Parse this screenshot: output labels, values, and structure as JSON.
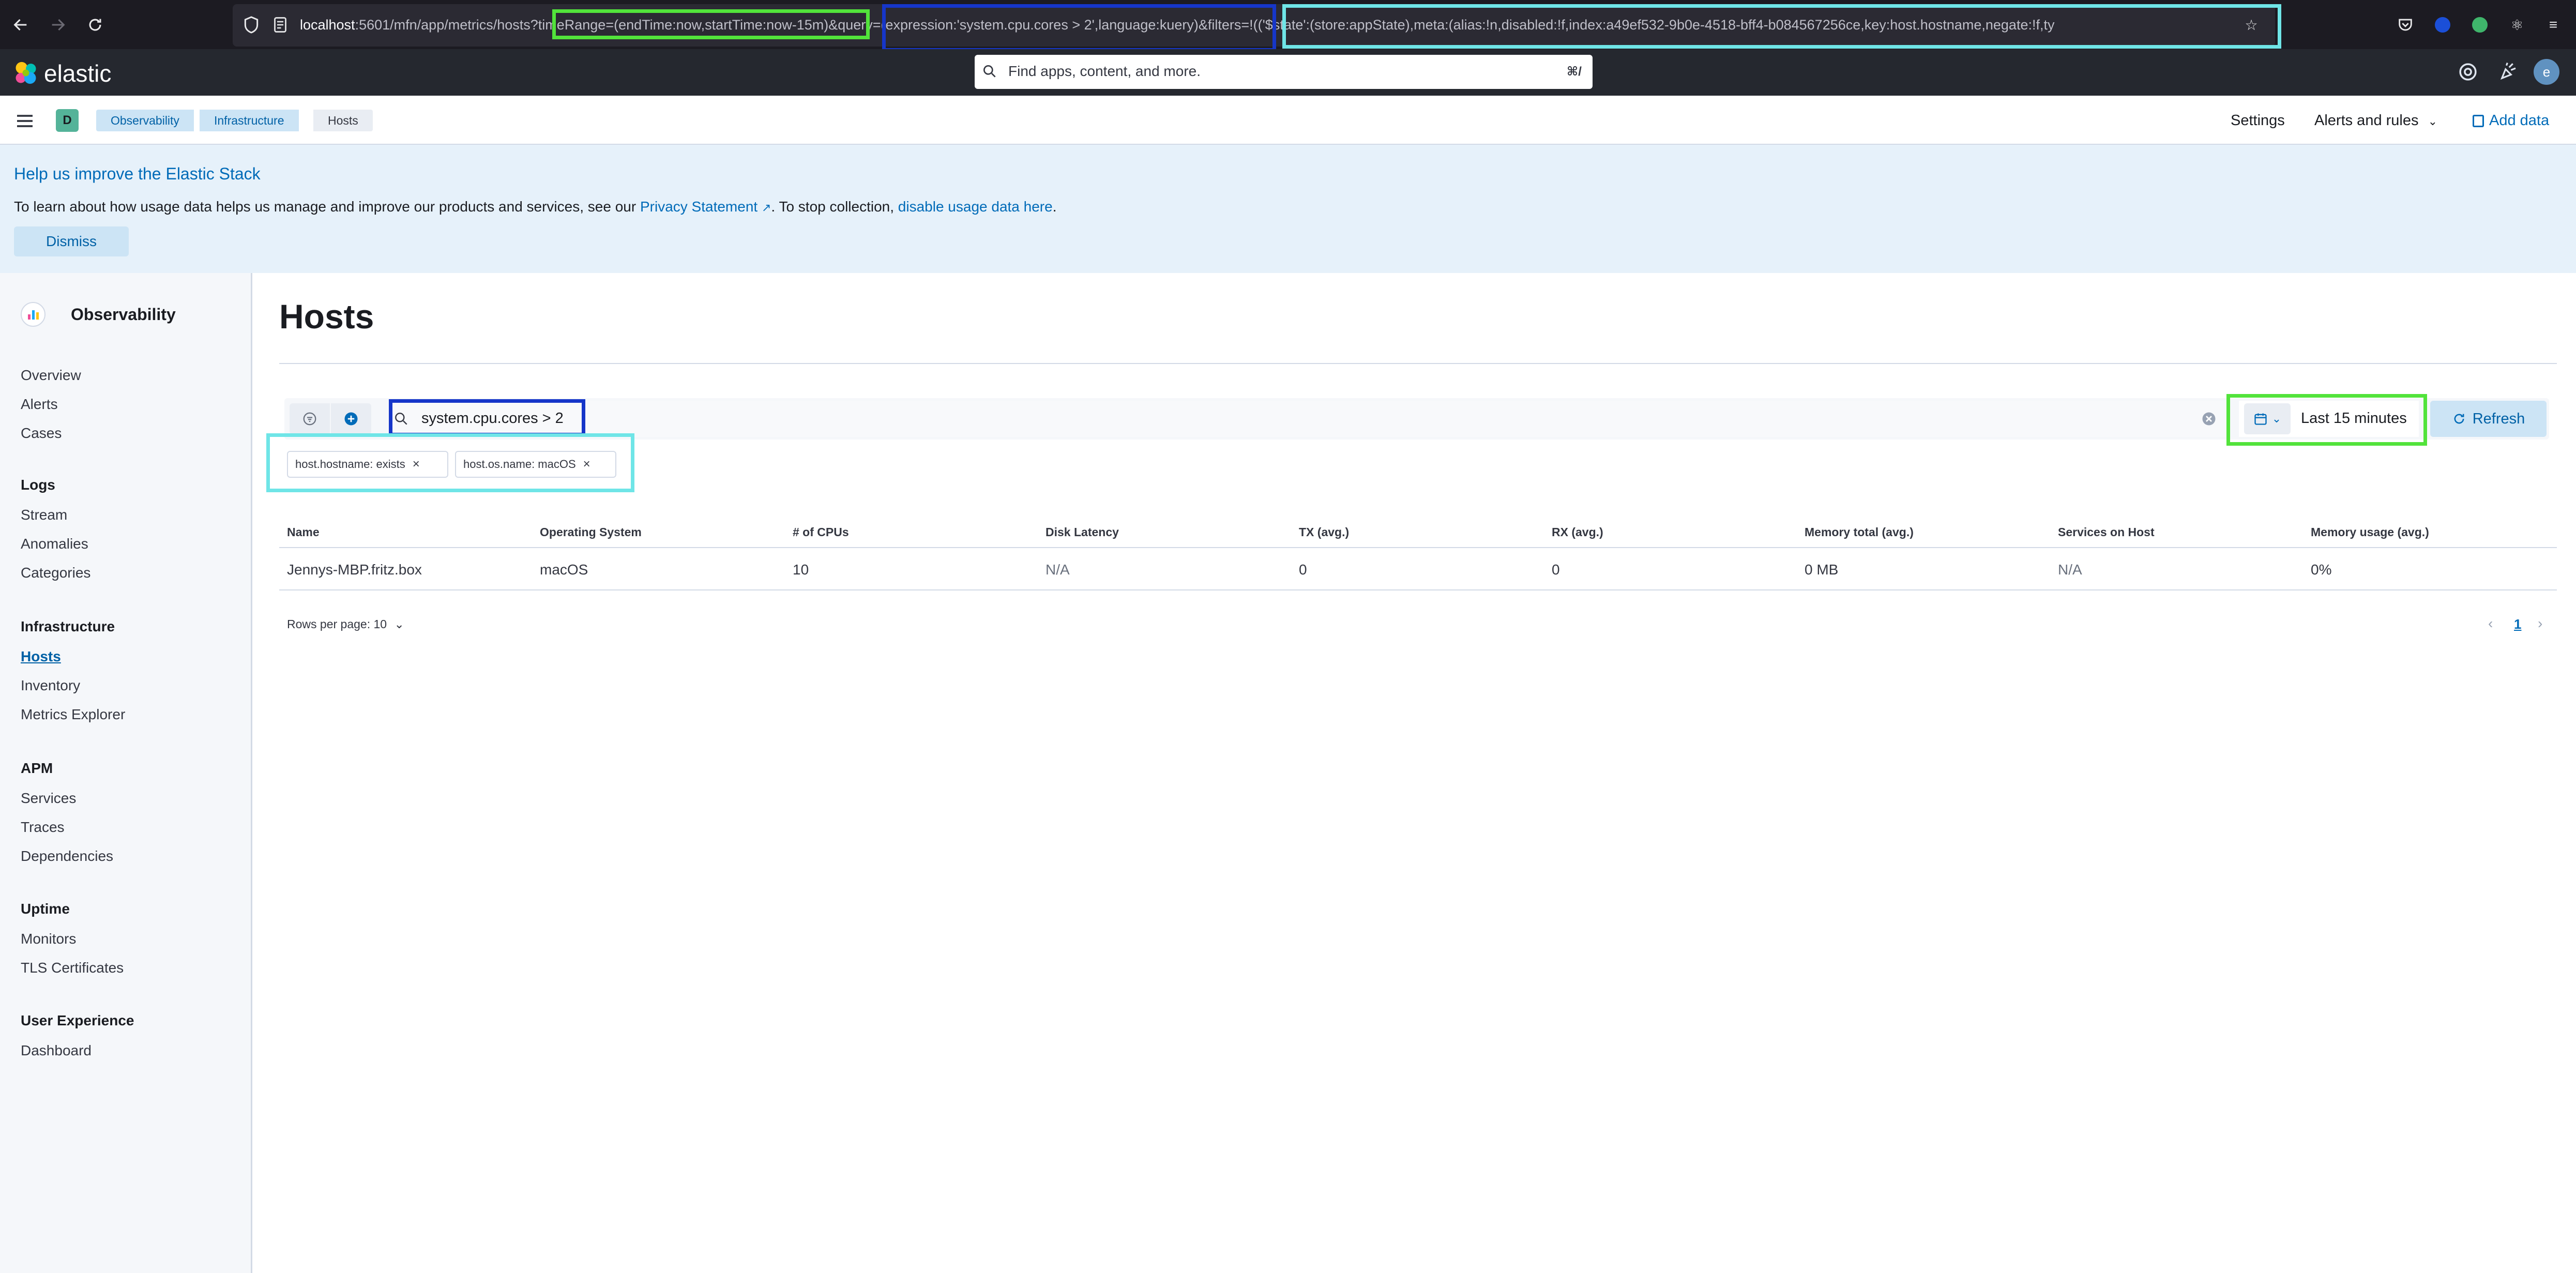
{
  "browser": {
    "url_host": "localhost",
    "url_rest": ":5601/mfn/app/metrics/hosts?timeRange=(endTime:now,startTime:now-15m)&query=(expression:'system.cpu.cores > 2',language:kuery)&filters=!(('$state':(store:appState),meta:(alias:!n,disabled:!f,index:a49ef532-9b0e-4518-bff4-b084567256ce,key:host.hostname,negate:!f,ty",
    "back_icon": "arrow-left-icon",
    "forward_icon": "arrow-right-icon",
    "reload_icon": "reload-icon"
  },
  "header": {
    "brand": "elastic",
    "search_placeholder": "Find apps, content, and more.",
    "search_shortcut": "⌘/",
    "avatar_letter": "e"
  },
  "subheader": {
    "space_letter": "D",
    "breadcrumbs": [
      "Observability",
      "Infrastructure",
      "Hosts"
    ],
    "settings": "Settings",
    "alerts_rules": "Alerts and rules",
    "add_data": "Add data"
  },
  "banner": {
    "title": "Help us improve the Elastic Stack",
    "body_pre": "To learn about how usage data helps us manage and improve our products and services, see our ",
    "privacy_link": "Privacy Statement",
    "body_mid": ". To stop collection, ",
    "disable_link": "disable usage data here",
    "body_end": ".",
    "dismiss": "Dismiss"
  },
  "sidebar": {
    "title": "Observability",
    "top_items": [
      "Overview",
      "Alerts",
      "Cases"
    ],
    "sections": [
      {
        "heading": "Logs",
        "items": [
          "Stream",
          "Anomalies",
          "Categories"
        ]
      },
      {
        "heading": "Infrastructure",
        "items": [
          "Hosts",
          "Inventory",
          "Metrics Explorer"
        ]
      },
      {
        "heading": "APM",
        "items": [
          "Services",
          "Traces",
          "Dependencies"
        ]
      },
      {
        "heading": "Uptime",
        "items": [
          "Monitors",
          "TLS Certificates"
        ]
      },
      {
        "heading": "User Experience",
        "items": [
          "Dashboard"
        ]
      }
    ],
    "active_item": "Hosts"
  },
  "main": {
    "title": "Hosts",
    "query": "system.cpu.cores > 2",
    "date_range": "Last 15 minutes",
    "refresh": "Refresh",
    "filters": [
      "host.hostname: exists",
      "host.os.name: macOS"
    ],
    "table": {
      "columns": [
        "Name",
        "Operating System",
        "# of CPUs",
        "Disk Latency",
        "TX (avg.)",
        "RX (avg.)",
        "Memory total (avg.)",
        "Services on Host",
        "Memory usage (avg.)"
      ],
      "rows": [
        [
          "Jennys-MBP.fritz.box",
          "macOS",
          "10",
          "N/A",
          "0",
          "0",
          "0 MB",
          "N/A",
          "0%"
        ]
      ]
    },
    "rows_per_page": "Rows per page: 10",
    "current_page": "1"
  },
  "colors": {
    "highlight_green": "#52e33b",
    "highlight_blue": "#1636c9",
    "highlight_cyan": "#6fe5e7",
    "accent": "#006bb8"
  }
}
